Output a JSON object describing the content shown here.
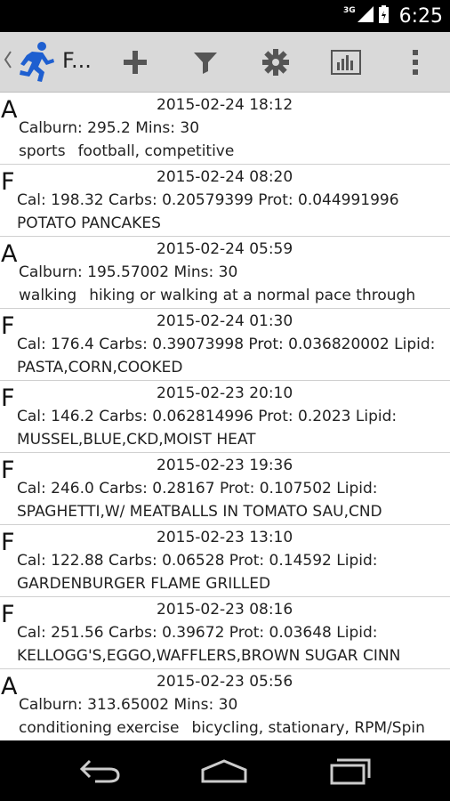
{
  "status_bar": {
    "network_label": "3G",
    "time": "6:25"
  },
  "action_bar": {
    "title": "F...",
    "icons": [
      "up-caret-icon",
      "running-man-logo-icon",
      "add-icon",
      "filter-icon",
      "settings-icon",
      "bar-chart-icon",
      "overflow-menu-icon"
    ]
  },
  "entries": [
    {
      "type": "A",
      "date": "2015-02-24 18:12",
      "line1": "Calburn: 295.2 Mins: 30",
      "category": "sports",
      "detail": "football, competitive"
    },
    {
      "type": "F",
      "date": "2015-02-24 08:20",
      "line1": "Cal: 198.32 Carbs: 0.20579399 Prot: 0.044991996",
      "line2": "POTATO PANCAKES"
    },
    {
      "type": "A",
      "date": "2015-02-24 05:59",
      "line1": "Calburn: 195.57002 Mins: 30",
      "category": "walking",
      "detail": "hiking or walking at a normal pace through"
    },
    {
      "type": "F",
      "date": "2015-02-24 01:30",
      "line1": "Cal: 176.4 Carbs: 0.39073998 Prot: 0.036820002 Lipid:",
      "line2": "PASTA,CORN,COOKED"
    },
    {
      "type": "F",
      "date": "2015-02-23 20:10",
      "line1": "Cal: 146.2 Carbs: 0.062814996 Prot: 0.2023 Lipid:",
      "line2": "MUSSEL,BLUE,CKD,MOIST HEAT"
    },
    {
      "type": "F",
      "date": "2015-02-23 19:36",
      "line1": "Cal: 246.0 Carbs: 0.28167 Prot: 0.107502 Lipid:",
      "line2": "SPAGHETTI,W/ MEATBALLS IN TOMATO SAU,CND"
    },
    {
      "type": "F",
      "date": "2015-02-23 13:10",
      "line1": "Cal: 122.88 Carbs: 0.06528 Prot: 0.14592 Lipid:",
      "line2": "GARDENBURGER FLAME GRILLED"
    },
    {
      "type": "F",
      "date": "2015-02-23 08:16",
      "line1": "Cal: 251.56 Carbs: 0.39672 Prot: 0.03648 Lipid:",
      "line2": "KELLOGG'S,EGGO,WAFFLERS,BROWN SUGAR CINN"
    },
    {
      "type": "A",
      "date": "2015-02-23 05:56",
      "line1": "Calburn: 313.65002 Mins: 30",
      "category": "conditioning exercise",
      "detail": "bicycling, stationary, RPM/Spin"
    }
  ],
  "nav_bar": {
    "icons": [
      "back-icon",
      "home-icon",
      "recent-apps-icon"
    ]
  }
}
